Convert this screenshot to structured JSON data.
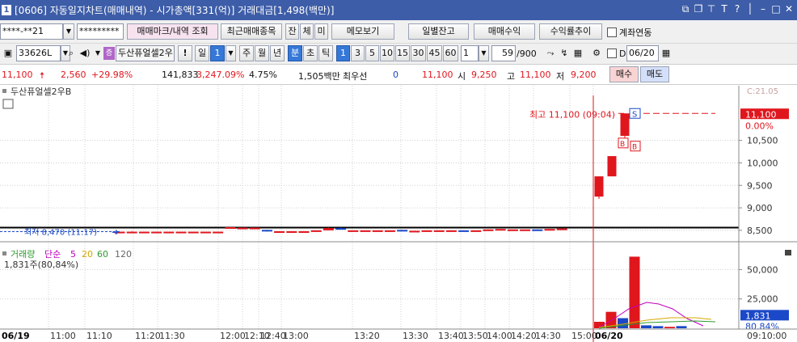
{
  "titlebar": {
    "window_number": "1",
    "title": "[0606] 자동일지차트(매매내역) - 시가총액[331(억)] 거래대금[1,498(백만)]"
  },
  "toolbar1": {
    "account_value": "****-**21",
    "password_value": "*********",
    "btn_trade_mark": "매매마크/내역 조회",
    "btn_recent_items": "최근매매종목",
    "btn_remaining": "잔",
    "btn_execution": "체",
    "btn_unexecuted": "미",
    "btn_memo": "메모보기",
    "btn_daily_balance": "일별잔고",
    "btn_trade_profit": "매매수익",
    "btn_return_trend": "수익률추이",
    "link_label": "계좌연동"
  },
  "toolbar2": {
    "stock_code": "33626L",
    "stock_name": "두산퓨얼셀2우",
    "period_day": "일",
    "period_day_num": "1",
    "period_week": "주",
    "period_month": "월",
    "period_year": "년",
    "period_minute": "분",
    "period_second": "초",
    "period_tick": "틱",
    "intervals": [
      "1",
      "3",
      "5",
      "10",
      "15",
      "30",
      "45",
      "60"
    ],
    "custom_interval": "1",
    "count_value": "59",
    "count_total": "/900",
    "date_prefix": "D",
    "date_value": "06/20"
  },
  "quote": {
    "price": "11,100",
    "change": "2,560",
    "change_pct": "+29.98%",
    "volume": "141,833",
    "volume_pct": "3,247.09%",
    "turnover_pct": "4.75%",
    "amount": "1,505백만",
    "best_bid_label": "최우선",
    "best_bid_value": "0",
    "best_ask_value": "11,100",
    "open_label": "시",
    "open_value": "9,250",
    "high_label": "고",
    "high_value": "11,100",
    "low_label": "저",
    "low_value": "9,200",
    "buy_button": "매수",
    "sell_button": "매도"
  },
  "price_panel": {
    "stock_label": "두산퓨얼셀2우B",
    "high_annotation": "최고 11,100 (09:04)",
    "low_annotation": "최저 8,470 (11:17)",
    "current_price_badge": "11,100",
    "current_pct_badge": "0.00%",
    "clipped_header": "C:21.05",
    "marker_sell": "S",
    "marker_buy": "B",
    "y_ticks": [
      "10,500",
      "10,000",
      "9,500",
      "9,000",
      "8,500"
    ]
  },
  "volume_panel": {
    "legend_label": "거래량",
    "ma_label": "단순",
    "ma_periods": [
      "5",
      "20",
      "60",
      "120"
    ],
    "current_volume": "1,831주(80,84%)",
    "badge_value": "1,831",
    "badge_pct": "80.84%",
    "y_ticks": [
      "50,000",
      "25,000"
    ]
  },
  "x_axis": {
    "labels": [
      "06/19",
      "11:00",
      "11:10",
      "11:20",
      "11:30",
      "12:00",
      "12:10",
      "12:40",
      "13:00",
      "13:20",
      "13:30",
      "13:40",
      "13:50",
      "14:00",
      "14:20",
      "14:30",
      "15:00",
      "06/20",
      "09:10:00"
    ]
  },
  "colors": {
    "titlebar": "#3d5da8",
    "up": "#e0161d",
    "down": "#1a48c8",
    "ma5": "#c000c0",
    "ma20": "#d4a800",
    "ma60": "#2e9b2e",
    "ma120": "#666666"
  },
  "chart_data": {
    "type": "candlestick",
    "ylim": [
      8300,
      11500
    ],
    "reference_line": 8560,
    "candles": [
      {
        "t": 0,
        "o": 8470,
        "h": 8470,
        "l": 8470,
        "c": 8470
      },
      {
        "t": 1,
        "o": 8470,
        "h": 8480,
        "l": 8470,
        "c": 8470
      },
      {
        "t": 2,
        "o": 8470,
        "h": 8470,
        "l": 8470,
        "c": 8470
      },
      {
        "t": 3,
        "o": 8470,
        "h": 8470,
        "l": 8470,
        "c": 8470
      },
      {
        "t": 4,
        "o": 8470,
        "h": 8470,
        "l": 8470,
        "c": 8470
      },
      {
        "t": 5,
        "o": 8470,
        "h": 8470,
        "l": 8470,
        "c": 8470
      },
      {
        "t": 6,
        "o": 8470,
        "h": 8470,
        "l": 8470,
        "c": 8470
      },
      {
        "t": 7,
        "o": 8470,
        "h": 8470,
        "l": 8470,
        "c": 8470
      },
      {
        "t": 8,
        "o": 8470,
        "h": 8470,
        "l": 8470,
        "c": 8470
      },
      {
        "t": 9,
        "o": 8560,
        "h": 8570,
        "l": 8550,
        "c": 8570
      },
      {
        "t": 10,
        "o": 8560,
        "h": 8560,
        "l": 8560,
        "c": 8560
      },
      {
        "t": 11,
        "o": 8560,
        "h": 8560,
        "l": 8560,
        "c": 8560
      },
      {
        "t": 12,
        "o": 8510,
        "h": 8510,
        "l": 8470,
        "c": 8480
      },
      {
        "t": 13,
        "o": 8480,
        "h": 8480,
        "l": 8480,
        "c": 8480
      },
      {
        "t": 14,
        "o": 8480,
        "h": 8480,
        "l": 8480,
        "c": 8480
      },
      {
        "t": 15,
        "o": 8480,
        "h": 8480,
        "l": 8480,
        "c": 8480
      },
      {
        "t": 16,
        "o": 8480,
        "h": 8500,
        "l": 8480,
        "c": 8500
      },
      {
        "t": 17,
        "o": 8500,
        "h": 8560,
        "l": 8500,
        "c": 8550
      },
      {
        "t": 18,
        "o": 8550,
        "h": 8560,
        "l": 8530,
        "c": 8530
      },
      {
        "t": 19,
        "o": 8500,
        "h": 8500,
        "l": 8500,
        "c": 8500
      },
      {
        "t": 20,
        "o": 8500,
        "h": 8500,
        "l": 8500,
        "c": 8500
      },
      {
        "t": 21,
        "o": 8500,
        "h": 8500,
        "l": 8500,
        "c": 8500
      },
      {
        "t": 22,
        "o": 8500,
        "h": 8500,
        "l": 8500,
        "c": 8500
      },
      {
        "t": 23,
        "o": 8510,
        "h": 8510,
        "l": 8490,
        "c": 8490
      },
      {
        "t": 24,
        "o": 8490,
        "h": 8490,
        "l": 8490,
        "c": 8490
      },
      {
        "t": 25,
        "o": 8500,
        "h": 8500,
        "l": 8500,
        "c": 8500
      },
      {
        "t": 26,
        "o": 8500,
        "h": 8500,
        "l": 8500,
        "c": 8500
      },
      {
        "t": 27,
        "o": 8500,
        "h": 8500,
        "l": 8500,
        "c": 8500
      },
      {
        "t": 28,
        "o": 8500,
        "h": 8500,
        "l": 8480,
        "c": 8480
      },
      {
        "t": 29,
        "o": 8480,
        "h": 8500,
        "l": 8480,
        "c": 8500
      },
      {
        "t": 30,
        "o": 8500,
        "h": 8520,
        "l": 8500,
        "c": 8520
      },
      {
        "t": 31,
        "o": 8520,
        "h": 8530,
        "l": 8520,
        "c": 8530
      },
      {
        "t": 32,
        "o": 8520,
        "h": 8520,
        "l": 8520,
        "c": 8520
      },
      {
        "t": 33,
        "o": 8520,
        "h": 8520,
        "l": 8520,
        "c": 8520
      },
      {
        "t": 34,
        "o": 8520,
        "h": 8520,
        "l": 8510,
        "c": 8510
      },
      {
        "t": 35,
        "o": 8510,
        "h": 8530,
        "l": 8510,
        "c": 8530
      },
      {
        "t": 36,
        "o": 8530,
        "h": 8540,
        "l": 8530,
        "c": 8540
      },
      {
        "t": 37,
        "o": 9250,
        "h": 9400,
        "l": 9200,
        "c": 9700
      },
      {
        "t": 38,
        "o": 9700,
        "h": 10150,
        "l": 9700,
        "c": 10150
      },
      {
        "t": 39,
        "o": 10600,
        "h": 11100,
        "l": 10550,
        "c": 11100
      }
    ],
    "volume_ylim": [
      0,
      62000
    ],
    "volume": [
      {
        "t": 37,
        "v": 5500,
        "up": true
      },
      {
        "t": 38,
        "v": 14000,
        "up": true
      },
      {
        "t": 39,
        "v": 8600,
        "up": false
      },
      {
        "t": 40,
        "v": 61000,
        "up": true
      },
      {
        "t": 41,
        "v": 2500,
        "up": false
      },
      {
        "t": 42,
        "v": 1800,
        "up": false
      },
      {
        "t": 43,
        "v": 1200,
        "up": true
      },
      {
        "t": 44,
        "v": 1831,
        "up": false
      }
    ]
  }
}
